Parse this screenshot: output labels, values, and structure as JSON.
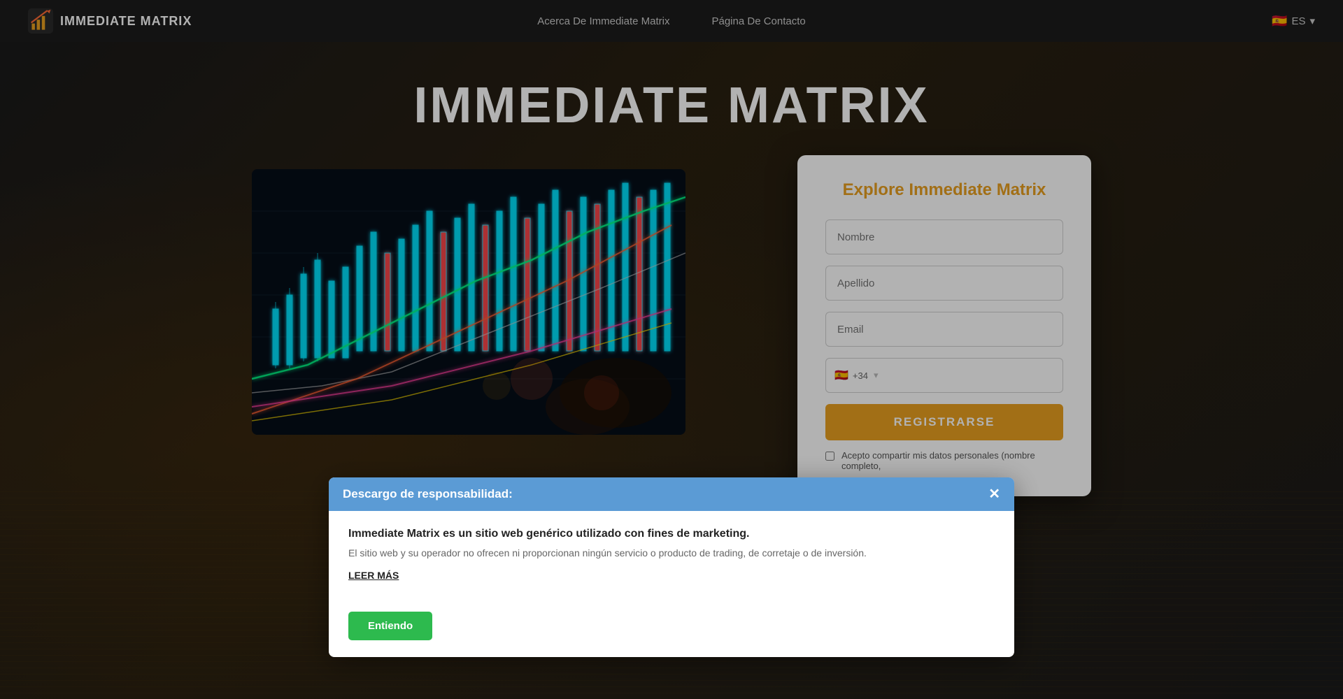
{
  "brand": {
    "name": "IMMEDIATE MATRIX",
    "icon_alt": "chart-icon"
  },
  "navbar": {
    "link1": "Acerca De Immediate Matrix",
    "link2": "Página De Contacto",
    "lang_code": "ES",
    "lang_flag": "🇪🇸"
  },
  "hero": {
    "title": "IMMEDIATE MATRIX"
  },
  "form": {
    "title_static": "Explore ",
    "title_brand": "Immediate Matrix",
    "field_nombre_placeholder": "Nombre",
    "field_apellido_placeholder": "Apellido",
    "field_email_placeholder": "Email",
    "field_phone_placeholder": "",
    "register_button": "REGISTRARSE",
    "checkbox_text": "Acepto compartir mis datos personales (nombre completo,"
  },
  "disclaimer": {
    "header_title": "Descargo de responsabilidad:",
    "close_symbol": "✕",
    "main_text": "Immediate Matrix es un sitio web genérico utilizado con fines de marketing.",
    "sub_text": "El sitio web y su operador no ofrecen ni proporcionan ningún servicio o producto de trading, de corretaje o de inversión.",
    "read_more": "LEER MÁS",
    "accept_button": "Entiendo"
  }
}
